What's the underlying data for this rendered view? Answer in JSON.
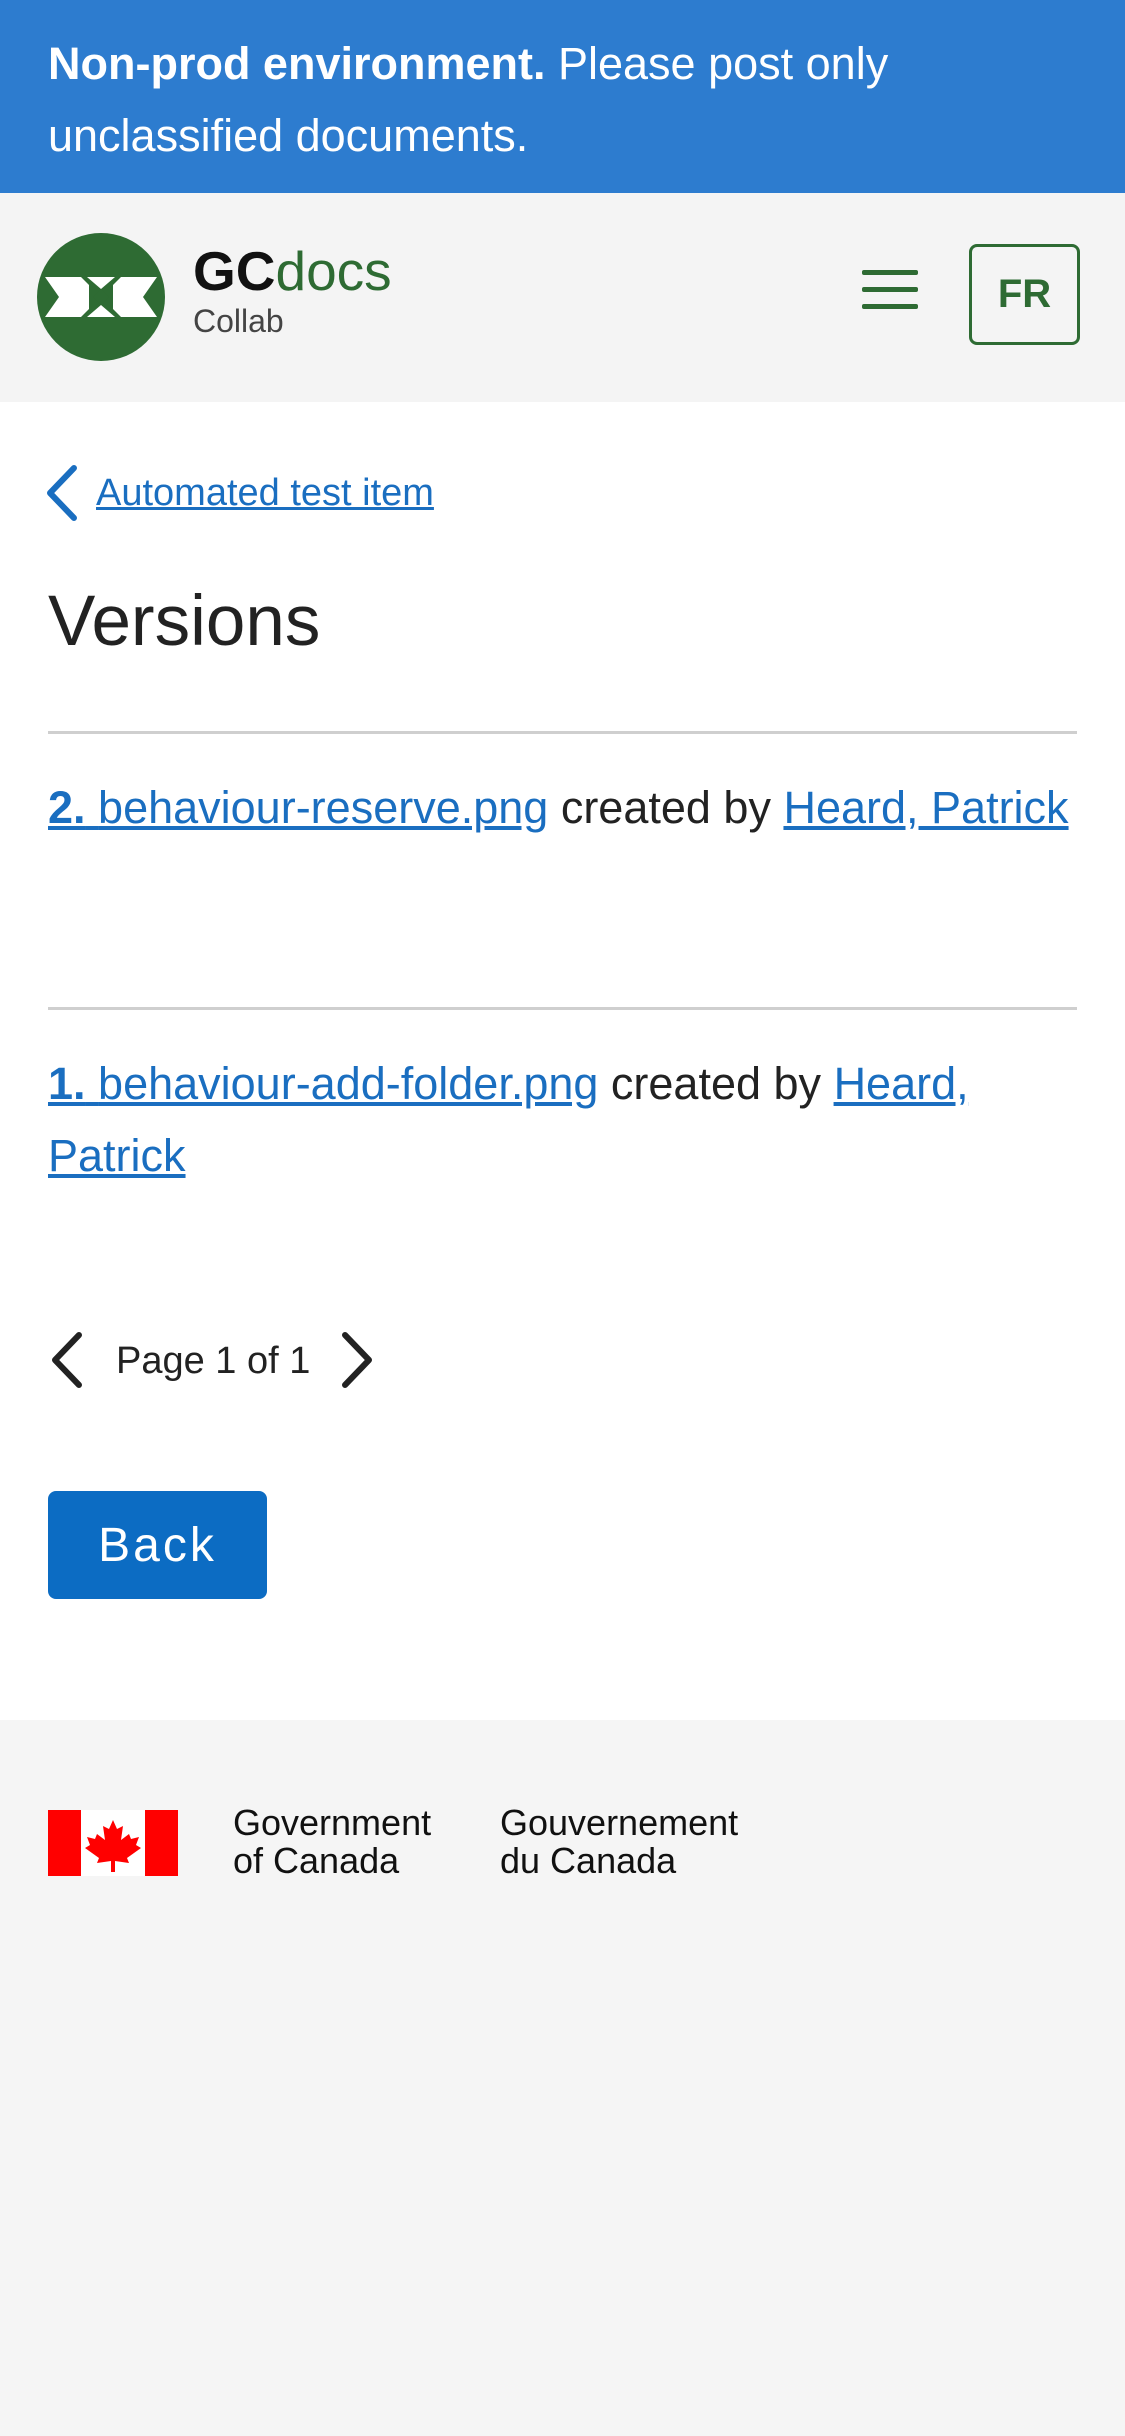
{
  "banner": {
    "bold_text": "Non-prod environment.",
    "text": " Please post only unclassified documents."
  },
  "header": {
    "brand_gc": "GC",
    "brand_docs": "docs",
    "brand_sub": "Collab",
    "menu_icon": "hamburger-menu-icon",
    "lang_label": "FR"
  },
  "breadcrumb": {
    "link_label": "Automated test item"
  },
  "page": {
    "title": "Versions"
  },
  "versions": [
    {
      "number": "2.",
      "file": "behaviour-reserve.png",
      "created_by_label": " created by ",
      "author": "Heard, Patrick"
    },
    {
      "number": "1.",
      "file": "behaviour-add-folder.png",
      "created_by_label": " created by ",
      "author": "Heard, Patrick"
    }
  ],
  "pagination": {
    "text": "Page 1 of 1"
  },
  "actions": {
    "back_label": "Back"
  },
  "footer": {
    "gov_en_line1": "Government",
    "gov_en_line2": "of Canada",
    "gov_fr_line1": "Gouvernement",
    "gov_fr_line2": "du Canada"
  },
  "colors": {
    "banner_bg": "#2d7ccf",
    "brand_green": "#2e6b33",
    "link_blue": "#1a6ec0",
    "button_blue": "#0c6cc3",
    "flag_red": "#ff0000"
  }
}
